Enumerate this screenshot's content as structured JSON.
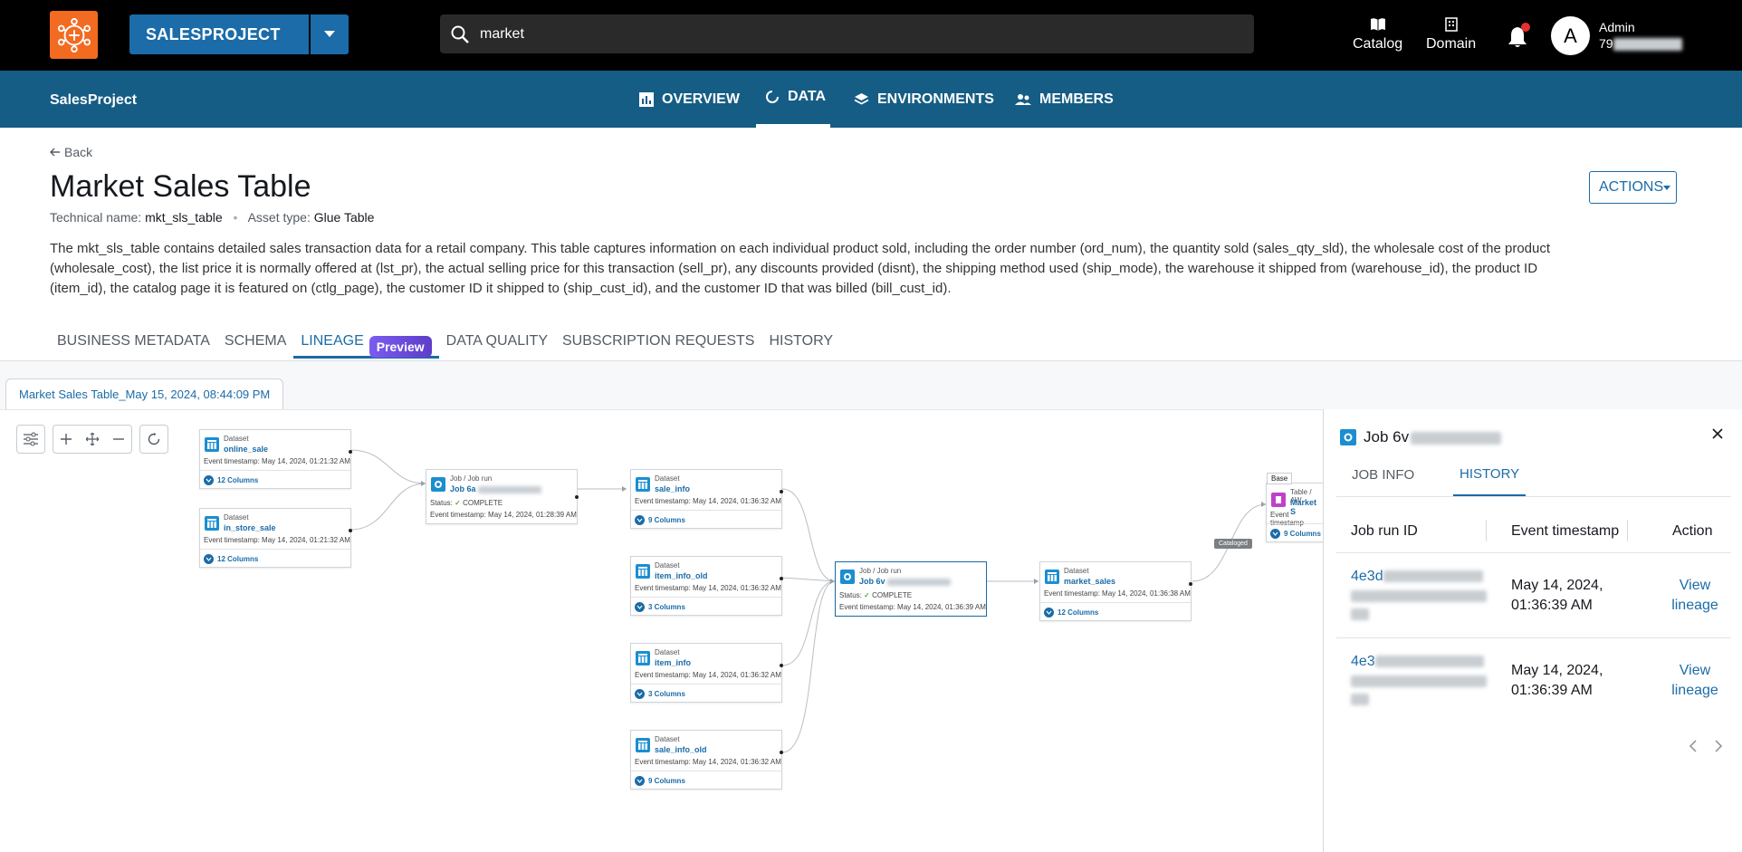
{
  "topbar": {
    "project_button": "SALESPROJECT",
    "search_value": "market",
    "nav": [
      {
        "label": "Catalog"
      },
      {
        "label": "Domain"
      }
    ],
    "user": {
      "avatar_letter": "A",
      "name": "Admin",
      "id_prefix": "79"
    }
  },
  "subnav": {
    "project_name": "SalesProject",
    "tabs": [
      {
        "label": "OVERVIEW"
      },
      {
        "label": "DATA"
      },
      {
        "label": "ENVIRONMENTS"
      },
      {
        "label": "MEMBERS"
      }
    ],
    "active_tab": "DATA"
  },
  "asset": {
    "back_label": "Back",
    "title": "Market Sales Table",
    "technical_name_label": "Technical name:",
    "technical_name": "mkt_sls_table",
    "asset_type_label": "Asset type:",
    "asset_type": "Glue Table",
    "actions_label": "ACTIONS",
    "description": "The mkt_sls_table contains detailed sales transaction data for a retail company. This table captures information on each individual product sold, including the order number (ord_num), the quantity sold (sales_qty_sld), the wholesale cost of the product (wholesale_cost), the list price it is normally offered at (lst_pr), the actual selling price for this transaction (sell_pr), any discounts provided (disnt), the shipping method used (ship_mode), the warehouse it shipped from (warehouse_id), the product ID (item_id), the catalog page it is featured on (ctlg_page), the customer ID it shipped to (ship_cust_id), and the customer ID that was billed (bill_cust_id)."
  },
  "asset_tabs": {
    "items": [
      {
        "label": "BUSINESS METADATA"
      },
      {
        "label": "SCHEMA"
      },
      {
        "label": "LINEAGE"
      },
      {
        "label": "DATA QUALITY"
      },
      {
        "label": "SUBSCRIPTION REQUESTS"
      },
      {
        "label": "HISTORY"
      }
    ],
    "preview_badge": "Preview",
    "active": "LINEAGE"
  },
  "lineage": {
    "snapshot_tab": "Market Sales Table_May 15, 2024, 08:44:09 PM",
    "cataloged_label": "Cataloged",
    "nodes": {
      "online_sale": {
        "type": "Dataset",
        "name": "online_sale",
        "ts": "Event timestamp: May 14, 2024, 01:21:32 AM",
        "cols": "12 Columns"
      },
      "in_store_sale": {
        "type": "Dataset",
        "name": "in_store_sale",
        "ts": "Event timestamp: May 14, 2024, 01:21:32 AM",
        "cols": "12 Columns"
      },
      "job_a": {
        "type": "Job / Job run",
        "name": "Job 6a",
        "status_label": "Status:",
        "status": "COMPLETE",
        "ts": "Event timestamp: May 14, 2024, 01:28:39 AM"
      },
      "sale_info": {
        "type": "Dataset",
        "name": "sale_info",
        "ts": "Event timestamp: May 14, 2024, 01:36:32 AM",
        "cols": "9 Columns"
      },
      "item_info_old": {
        "type": "Dataset",
        "name": "item_info_old",
        "ts": "Event timestamp: May 14, 2024, 01:36:32 AM",
        "cols": "3 Columns"
      },
      "item_info": {
        "type": "Dataset",
        "name": "item_info",
        "ts": "Event timestamp: May 14, 2024, 01:36:32 AM",
        "cols": "3 Columns"
      },
      "sale_info_old": {
        "type": "Dataset",
        "name": "sale_info_old",
        "ts": "Event timestamp: May 14, 2024, 01:36:32 AM",
        "cols": "9 Columns"
      },
      "job_b": {
        "type": "Job / Job run",
        "name": "Job 6v",
        "status_label": "Status:",
        "status": "COMPLETE",
        "ts": "Event timestamp: May 14, 2024, 01:36:39 AM"
      },
      "market_sales": {
        "type": "Dataset",
        "name": "market_sales",
        "ts": "Event timestamp: May 14, 2024, 01:36:38 AM",
        "cols": "12 Columns"
      },
      "market_table": {
        "badge": "Base",
        "type": "Table / AW",
        "name": "Market S",
        "ts": "Event timestamp",
        "cols": "9 Columns"
      }
    }
  },
  "panel": {
    "title": "Job 6v",
    "tabs": [
      {
        "label": "JOB INFO"
      },
      {
        "label": "HISTORY"
      }
    ],
    "active_tab": "HISTORY",
    "columns": [
      "Job run ID",
      "Event timestamp",
      "Action"
    ],
    "rows": [
      {
        "run_id": "4e3d",
        "timestamp": "May 14, 2024, 01:36:39 AM",
        "action": "View lineage"
      },
      {
        "run_id": "4e3",
        "timestamp": "May 14, 2024, 01:36:39 AM",
        "action": "View lineage"
      }
    ]
  }
}
